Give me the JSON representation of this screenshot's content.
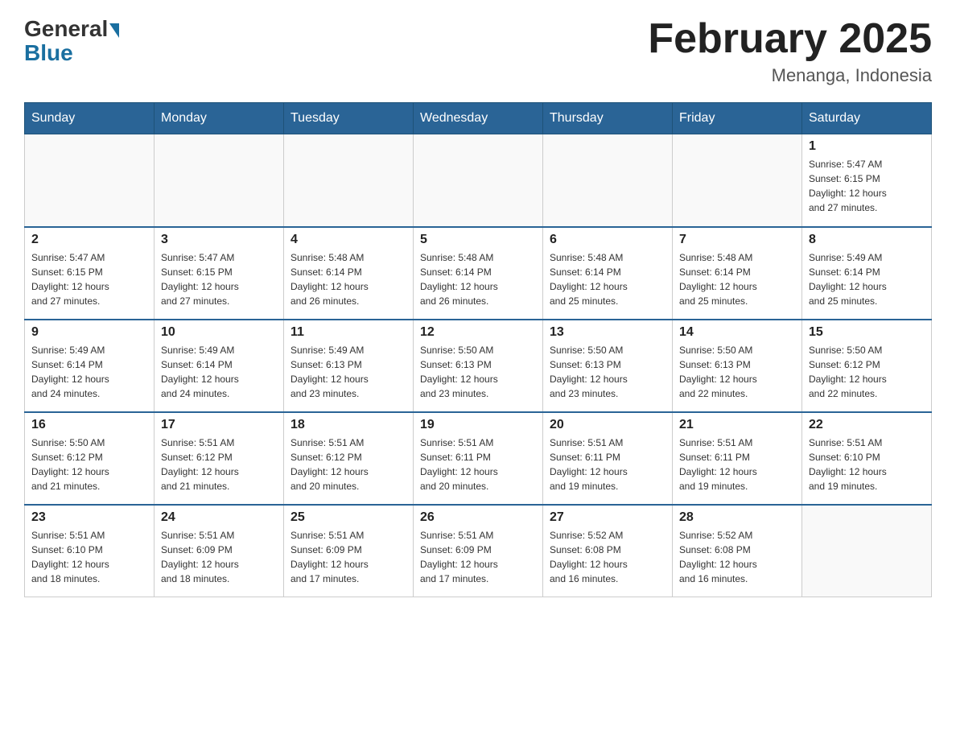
{
  "header": {
    "logo_general": "General",
    "logo_blue": "Blue",
    "title": "February 2025",
    "subtitle": "Menanga, Indonesia"
  },
  "weekdays": [
    "Sunday",
    "Monday",
    "Tuesday",
    "Wednesday",
    "Thursday",
    "Friday",
    "Saturday"
  ],
  "weeks": [
    [
      {
        "day": "",
        "info": ""
      },
      {
        "day": "",
        "info": ""
      },
      {
        "day": "",
        "info": ""
      },
      {
        "day": "",
        "info": ""
      },
      {
        "day": "",
        "info": ""
      },
      {
        "day": "",
        "info": ""
      },
      {
        "day": "1",
        "info": "Sunrise: 5:47 AM\nSunset: 6:15 PM\nDaylight: 12 hours\nand 27 minutes."
      }
    ],
    [
      {
        "day": "2",
        "info": "Sunrise: 5:47 AM\nSunset: 6:15 PM\nDaylight: 12 hours\nand 27 minutes."
      },
      {
        "day": "3",
        "info": "Sunrise: 5:47 AM\nSunset: 6:15 PM\nDaylight: 12 hours\nand 27 minutes."
      },
      {
        "day": "4",
        "info": "Sunrise: 5:48 AM\nSunset: 6:14 PM\nDaylight: 12 hours\nand 26 minutes."
      },
      {
        "day": "5",
        "info": "Sunrise: 5:48 AM\nSunset: 6:14 PM\nDaylight: 12 hours\nand 26 minutes."
      },
      {
        "day": "6",
        "info": "Sunrise: 5:48 AM\nSunset: 6:14 PM\nDaylight: 12 hours\nand 25 minutes."
      },
      {
        "day": "7",
        "info": "Sunrise: 5:48 AM\nSunset: 6:14 PM\nDaylight: 12 hours\nand 25 minutes."
      },
      {
        "day": "8",
        "info": "Sunrise: 5:49 AM\nSunset: 6:14 PM\nDaylight: 12 hours\nand 25 minutes."
      }
    ],
    [
      {
        "day": "9",
        "info": "Sunrise: 5:49 AM\nSunset: 6:14 PM\nDaylight: 12 hours\nand 24 minutes."
      },
      {
        "day": "10",
        "info": "Sunrise: 5:49 AM\nSunset: 6:14 PM\nDaylight: 12 hours\nand 24 minutes."
      },
      {
        "day": "11",
        "info": "Sunrise: 5:49 AM\nSunset: 6:13 PM\nDaylight: 12 hours\nand 23 minutes."
      },
      {
        "day": "12",
        "info": "Sunrise: 5:50 AM\nSunset: 6:13 PM\nDaylight: 12 hours\nand 23 minutes."
      },
      {
        "day": "13",
        "info": "Sunrise: 5:50 AM\nSunset: 6:13 PM\nDaylight: 12 hours\nand 23 minutes."
      },
      {
        "day": "14",
        "info": "Sunrise: 5:50 AM\nSunset: 6:13 PM\nDaylight: 12 hours\nand 22 minutes."
      },
      {
        "day": "15",
        "info": "Sunrise: 5:50 AM\nSunset: 6:12 PM\nDaylight: 12 hours\nand 22 minutes."
      }
    ],
    [
      {
        "day": "16",
        "info": "Sunrise: 5:50 AM\nSunset: 6:12 PM\nDaylight: 12 hours\nand 21 minutes."
      },
      {
        "day": "17",
        "info": "Sunrise: 5:51 AM\nSunset: 6:12 PM\nDaylight: 12 hours\nand 21 minutes."
      },
      {
        "day": "18",
        "info": "Sunrise: 5:51 AM\nSunset: 6:12 PM\nDaylight: 12 hours\nand 20 minutes."
      },
      {
        "day": "19",
        "info": "Sunrise: 5:51 AM\nSunset: 6:11 PM\nDaylight: 12 hours\nand 20 minutes."
      },
      {
        "day": "20",
        "info": "Sunrise: 5:51 AM\nSunset: 6:11 PM\nDaylight: 12 hours\nand 19 minutes."
      },
      {
        "day": "21",
        "info": "Sunrise: 5:51 AM\nSunset: 6:11 PM\nDaylight: 12 hours\nand 19 minutes."
      },
      {
        "day": "22",
        "info": "Sunrise: 5:51 AM\nSunset: 6:10 PM\nDaylight: 12 hours\nand 19 minutes."
      }
    ],
    [
      {
        "day": "23",
        "info": "Sunrise: 5:51 AM\nSunset: 6:10 PM\nDaylight: 12 hours\nand 18 minutes."
      },
      {
        "day": "24",
        "info": "Sunrise: 5:51 AM\nSunset: 6:09 PM\nDaylight: 12 hours\nand 18 minutes."
      },
      {
        "day": "25",
        "info": "Sunrise: 5:51 AM\nSunset: 6:09 PM\nDaylight: 12 hours\nand 17 minutes."
      },
      {
        "day": "26",
        "info": "Sunrise: 5:51 AM\nSunset: 6:09 PM\nDaylight: 12 hours\nand 17 minutes."
      },
      {
        "day": "27",
        "info": "Sunrise: 5:52 AM\nSunset: 6:08 PM\nDaylight: 12 hours\nand 16 minutes."
      },
      {
        "day": "28",
        "info": "Sunrise: 5:52 AM\nSunset: 6:08 PM\nDaylight: 12 hours\nand 16 minutes."
      },
      {
        "day": "",
        "info": ""
      }
    ]
  ]
}
